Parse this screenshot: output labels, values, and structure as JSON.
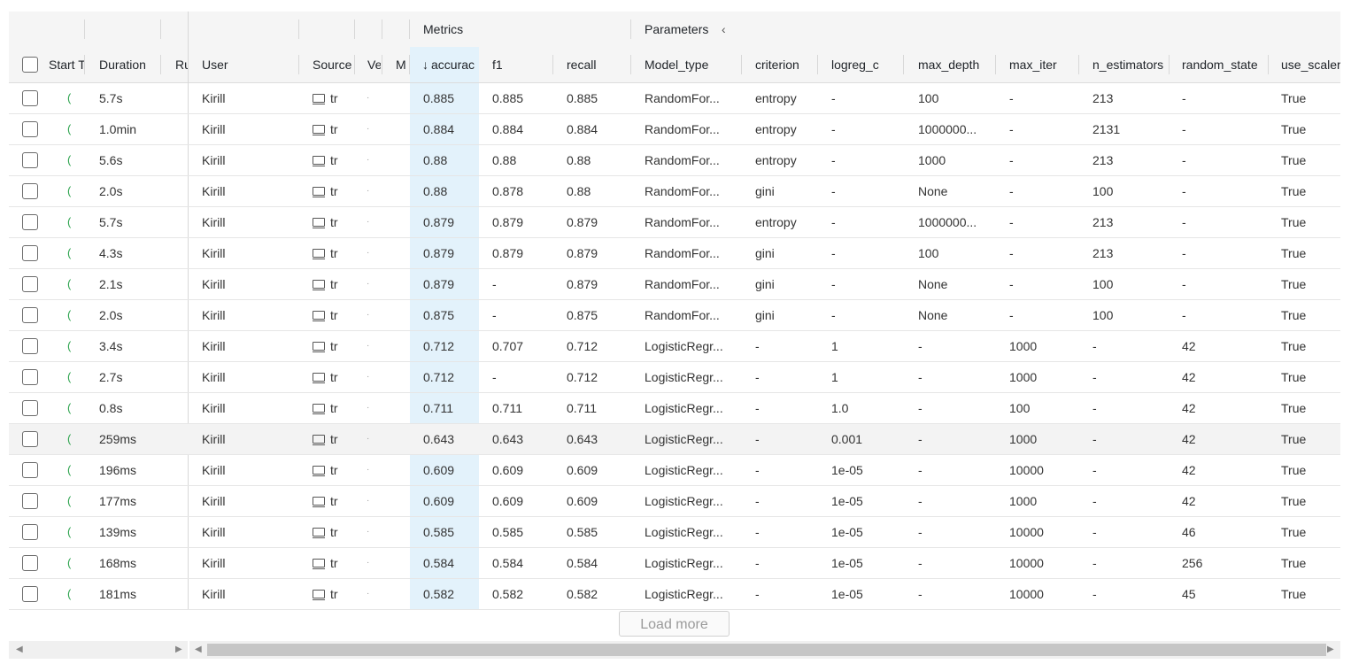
{
  "header_groups": {
    "metrics": "Metrics",
    "parameters": "Parameters",
    "collapse_icon": "chevron-left-icon"
  },
  "columns": {
    "start_time": "Start T",
    "duration": "Duration",
    "run_name": "Ru",
    "user": "User",
    "source": "Source",
    "version": "Ve",
    "models": "M",
    "accuracy": "accurac",
    "f1": "f1",
    "recall": "recall",
    "model_type": "Model_type",
    "criterion": "criterion",
    "logreg_c": "logreg_c",
    "max_depth": "max_depth",
    "max_iter": "max_iter",
    "n_estimators": "n_estimators",
    "random_state": "random_state",
    "use_scaler": "use_scaler"
  },
  "sort_icon": "arrow-down-icon",
  "rows": [
    {
      "status": "(",
      "duration": "5.7s",
      "user": "Kirill",
      "source": "tr",
      "version": "·",
      "accuracy": "0.885",
      "f1": "0.885",
      "recall": "0.885",
      "model_type": "RandomFor...",
      "criterion": "entropy",
      "logreg_c": "-",
      "max_depth": "100",
      "max_iter": "-",
      "n_estimators": "213",
      "random_state": "-",
      "use_scaler": "True"
    },
    {
      "status": "(",
      "duration": "1.0min",
      "user": "Kirill",
      "source": "tr",
      "version": "·",
      "accuracy": "0.884",
      "f1": "0.884",
      "recall": "0.884",
      "model_type": "RandomFor...",
      "criterion": "entropy",
      "logreg_c": "-",
      "max_depth": "1000000...",
      "max_iter": "-",
      "n_estimators": "2131",
      "random_state": "-",
      "use_scaler": "True"
    },
    {
      "status": "(",
      "duration": "5.6s",
      "user": "Kirill",
      "source": "tr",
      "version": "·",
      "accuracy": "0.88",
      "f1": "0.88",
      "recall": "0.88",
      "model_type": "RandomFor...",
      "criterion": "entropy",
      "logreg_c": "-",
      "max_depth": "1000",
      "max_iter": "-",
      "n_estimators": "213",
      "random_state": "-",
      "use_scaler": "True"
    },
    {
      "status": "(",
      "duration": "2.0s",
      "user": "Kirill",
      "source": "tr",
      "version": "·",
      "accuracy": "0.88",
      "f1": "0.878",
      "recall": "0.88",
      "model_type": "RandomFor...",
      "criterion": "gini",
      "logreg_c": "-",
      "max_depth": "None",
      "max_iter": "-",
      "n_estimators": "100",
      "random_state": "-",
      "use_scaler": "True"
    },
    {
      "status": "(",
      "duration": "5.7s",
      "user": "Kirill",
      "source": "tr",
      "version": "·",
      "accuracy": "0.879",
      "f1": "0.879",
      "recall": "0.879",
      "model_type": "RandomFor...",
      "criterion": "entropy",
      "logreg_c": "-",
      "max_depth": "1000000...",
      "max_iter": "-",
      "n_estimators": "213",
      "random_state": "-",
      "use_scaler": "True"
    },
    {
      "status": "(",
      "duration": "4.3s",
      "user": "Kirill",
      "source": "tr",
      "version": "·",
      "accuracy": "0.879",
      "f1": "0.879",
      "recall": "0.879",
      "model_type": "RandomFor...",
      "criterion": "gini",
      "logreg_c": "-",
      "max_depth": "100",
      "max_iter": "-",
      "n_estimators": "213",
      "random_state": "-",
      "use_scaler": "True"
    },
    {
      "status": "(",
      "duration": "2.1s",
      "user": "Kirill",
      "source": "tr",
      "version": "·",
      "accuracy": "0.879",
      "f1": "-",
      "recall": "0.879",
      "model_type": "RandomFor...",
      "criterion": "gini",
      "logreg_c": "-",
      "max_depth": "None",
      "max_iter": "-",
      "n_estimators": "100",
      "random_state": "-",
      "use_scaler": "True"
    },
    {
      "status": "(",
      "duration": "2.0s",
      "user": "Kirill",
      "source": "tr",
      "version": "·",
      "accuracy": "0.875",
      "f1": "-",
      "recall": "0.875",
      "model_type": "RandomFor...",
      "criterion": "gini",
      "logreg_c": "-",
      "max_depth": "None",
      "max_iter": "-",
      "n_estimators": "100",
      "random_state": "-",
      "use_scaler": "True"
    },
    {
      "status": "(",
      "duration": "3.4s",
      "user": "Kirill",
      "source": "tr",
      "version": "·",
      "accuracy": "0.712",
      "f1": "0.707",
      "recall": "0.712",
      "model_type": "LogisticRegr...",
      "criterion": "-",
      "logreg_c": "1",
      "max_depth": "-",
      "max_iter": "1000",
      "n_estimators": "-",
      "random_state": "42",
      "use_scaler": "True"
    },
    {
      "status": "(",
      "duration": "2.7s",
      "user": "Kirill",
      "source": "tr",
      "version": "·",
      "accuracy": "0.712",
      "f1": "-",
      "recall": "0.712",
      "model_type": "LogisticRegr...",
      "criterion": "-",
      "logreg_c": "1",
      "max_depth": "-",
      "max_iter": "1000",
      "n_estimators": "-",
      "random_state": "42",
      "use_scaler": "True"
    },
    {
      "status": "(",
      "duration": "0.8s",
      "user": "Kirill",
      "source": "tr",
      "version": "·",
      "accuracy": "0.711",
      "f1": "0.711",
      "recall": "0.711",
      "model_type": "LogisticRegr...",
      "criterion": "-",
      "logreg_c": "1.0",
      "max_depth": "-",
      "max_iter": "100",
      "n_estimators": "-",
      "random_state": "42",
      "use_scaler": "True"
    },
    {
      "status": "(",
      "duration": "259ms",
      "user": "Kirill",
      "source": "tr",
      "version": "·",
      "accuracy": "0.643",
      "f1": "0.643",
      "recall": "0.643",
      "model_type": "LogisticRegr...",
      "criterion": "-",
      "logreg_c": "0.001",
      "max_depth": "-",
      "max_iter": "1000",
      "n_estimators": "-",
      "random_state": "42",
      "use_scaler": "True",
      "highlighted": true
    },
    {
      "status": "(",
      "duration": "196ms",
      "user": "Kirill",
      "source": "tr",
      "version": "·",
      "accuracy": "0.609",
      "f1": "0.609",
      "recall": "0.609",
      "model_type": "LogisticRegr...",
      "criterion": "-",
      "logreg_c": "1e-05",
      "max_depth": "-",
      "max_iter": "10000",
      "n_estimators": "-",
      "random_state": "42",
      "use_scaler": "True"
    },
    {
      "status": "(",
      "duration": "177ms",
      "user": "Kirill",
      "source": "tr",
      "version": "·",
      "accuracy": "0.609",
      "f1": "0.609",
      "recall": "0.609",
      "model_type": "LogisticRegr...",
      "criterion": "-",
      "logreg_c": "1e-05",
      "max_depth": "-",
      "max_iter": "1000",
      "n_estimators": "-",
      "random_state": "42",
      "use_scaler": "True"
    },
    {
      "status": "(",
      "duration": "139ms",
      "user": "Kirill",
      "source": "tr",
      "version": "·",
      "accuracy": "0.585",
      "f1": "0.585",
      "recall": "0.585",
      "model_type": "LogisticRegr...",
      "criterion": "-",
      "logreg_c": "1e-05",
      "max_depth": "-",
      "max_iter": "10000",
      "n_estimators": "-",
      "random_state": "46",
      "use_scaler": "True"
    },
    {
      "status": "(",
      "duration": "168ms",
      "user": "Kirill",
      "source": "tr",
      "version": "·",
      "accuracy": "0.584",
      "f1": "0.584",
      "recall": "0.584",
      "model_type": "LogisticRegr...",
      "criterion": "-",
      "logreg_c": "1e-05",
      "max_depth": "-",
      "max_iter": "10000",
      "n_estimators": "-",
      "random_state": "256",
      "use_scaler": "True"
    },
    {
      "status": "(",
      "duration": "181ms",
      "user": "Kirill",
      "source": "tr",
      "version": "·",
      "accuracy": "0.582",
      "f1": "0.582",
      "recall": "0.582",
      "model_type": "LogisticRegr...",
      "criterion": "-",
      "logreg_c": "1e-05",
      "max_depth": "-",
      "max_iter": "10000",
      "n_estimators": "-",
      "random_state": "45",
      "use_scaler": "True"
    }
  ],
  "load_more": "Load more",
  "scrollbar_icons": {
    "left": "caret-left-icon",
    "right": "caret-right-icon"
  }
}
